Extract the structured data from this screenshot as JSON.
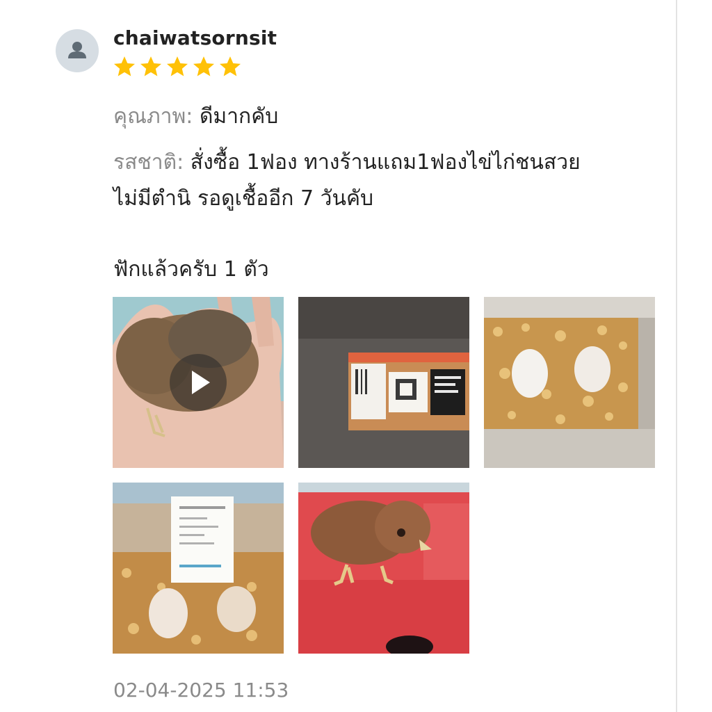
{
  "review": {
    "username": "chaiwatsornsit",
    "rating": 5,
    "rating_max": 5,
    "star_color": "#ffc107",
    "quality_label": "คุณภาพ:",
    "quality_value": "ดีมากคับ",
    "taste_label": "รสชาติ:",
    "taste_value_line1": "สั่งซื้อ 1ฟอง ทางร้านแถม1ฟองไข่ไก่ชนสวย",
    "taste_value_line2": "ไม่มีตำนิ รอดูเชื้ออีก 7 วันคับ",
    "comment": "ฟักแล้วครับ 1 ตัว",
    "timestamp": "02-04-2025 11:53"
  },
  "media": [
    {
      "kind": "video",
      "icon": "play-icon"
    },
    {
      "kind": "image"
    },
    {
      "kind": "image"
    },
    {
      "kind": "image"
    },
    {
      "kind": "image"
    }
  ]
}
